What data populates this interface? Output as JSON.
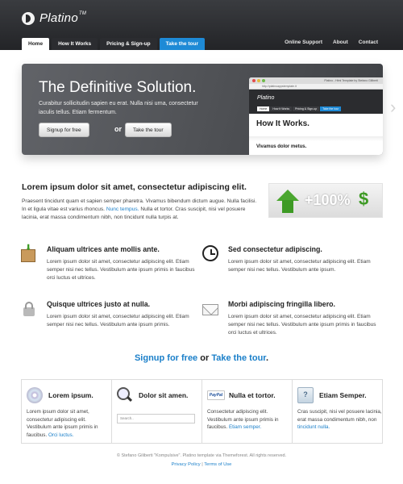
{
  "header": {
    "logo_text": "Platino",
    "logo_tm": "TM",
    "nav": [
      {
        "label": "Home",
        "active": true
      },
      {
        "label": "How It Works"
      },
      {
        "label": "Pricing & Sign-up"
      },
      {
        "label": "Take the tour",
        "accent": true
      }
    ],
    "nav_right": [
      "Online Support",
      "About",
      "Contact"
    ]
  },
  "hero": {
    "title": "The Definitive Solution.",
    "text": "Curabitur sollicitudin sapien eu erat. Nulla nisi urna, consectetur iaculis tellus. Etiam fermentum.",
    "signup_label": "Signup for free",
    "or": "or",
    "tour_label": "Take the tour",
    "screenshot": {
      "window_title": "Platino - Html Template by Stefano Giliberti",
      "url": "http://platinoappstemplate.it",
      "logo": "Platino",
      "nav": [
        "Home",
        "How It Works",
        "Pricing & Sign-up",
        "Take the tour"
      ],
      "heading": "How It Works.",
      "subheading": "Vivamus dolor metus."
    },
    "next_arrow": "›"
  },
  "intro": {
    "title": "Lorem ipsum dolor sit amet, consectetur adipiscing elit.",
    "text_before_link": "Praesent tincidunt quam et sapien semper pharetra. Vivamus bibendum dictum augue. Nulla facilisi. In et ligula vitae est varius rhoncus. ",
    "link": "Nunc tempus.",
    "text_after_link": " Nulla et tortor. Cras suscipit, nisi vel posuere lacinia, erat massa condimentum nibh, non tincidunt nulla turpis at.",
    "image_text": "+100%",
    "image_dollar": "$"
  },
  "features": [
    {
      "icon": "box-icon",
      "title": "Aliquam ultrices ante mollis ante.",
      "text": "Lorem ipsum dolor sit amet, consectetur adipiscing elit. Etiam semper nisi nec tellus. Vestibulum ante ipsum primis in faucibus orci luctus et ultrices."
    },
    {
      "icon": "clock-icon",
      "title": "Sed consectetur adipiscing.",
      "text": "Lorem ipsum dolor sit amet, consectetur adipiscing elit. Etiam semper nisi nec tellus. Vestibulum ante ipsum."
    },
    {
      "icon": "lock-icon",
      "title": "Quisque ultrices justo at nulla.",
      "text": "Lorem ipsum dolor sit amet, consectetur adipiscing elit. Etiam semper nisi nec tellus. Vestibulum ante ipsum primis."
    },
    {
      "icon": "envelope-icon",
      "title": "Morbi adipiscing fringilla libero.",
      "text": "Lorem ipsum dolor sit amet, consectetur adipiscing elit. Etiam semper nisi nec tellus. Vestibulum ante ipsum primis in faucibus orci luctus et ultrices."
    }
  ],
  "cta": {
    "signup": "Signup for free",
    "or": " or ",
    "tour": "Take the tour",
    "end": "."
  },
  "cards": [
    {
      "icon": "cd-icon",
      "title": "Lorem ipsum.",
      "text": "Lorem ipsum dolor sit amet, consectetur adipiscing elit. Vestibulum ante ipsum primis in faucibus. ",
      "link": "Orci luctus."
    },
    {
      "icon": "magnifier-icon",
      "title": "Dolor sit amen.",
      "search_placeholder": "Search.."
    },
    {
      "icon": "paypal-icon",
      "icon_text": "PayPal",
      "title": "Nulla et tortor.",
      "text": "Consectetur adipiscing elit. Vestibulum ante ipsum primis in faucibus. ",
      "link": "Etiam semper."
    },
    {
      "icon": "speech-bubble-icon",
      "icon_text": "?",
      "title": "Etiam Semper.",
      "text": "Cras suscipit, nisi vel posuere lacinia, erat massa condimentum nibh, non ",
      "link": "tincidunt nulla."
    }
  ],
  "footer": {
    "copyright": "© Stefano Giliberti \"Kompulsive\". Platino template via Themeforest. All rights reserved.",
    "privacy": "Privacy Policy",
    "sep": " | ",
    "terms": "Terms of Use"
  },
  "colors": {
    "accent": "#1e8ad6",
    "link": "#1a7fc9",
    "header_bg": "#2b2c30",
    "green": "#3d9a24"
  }
}
